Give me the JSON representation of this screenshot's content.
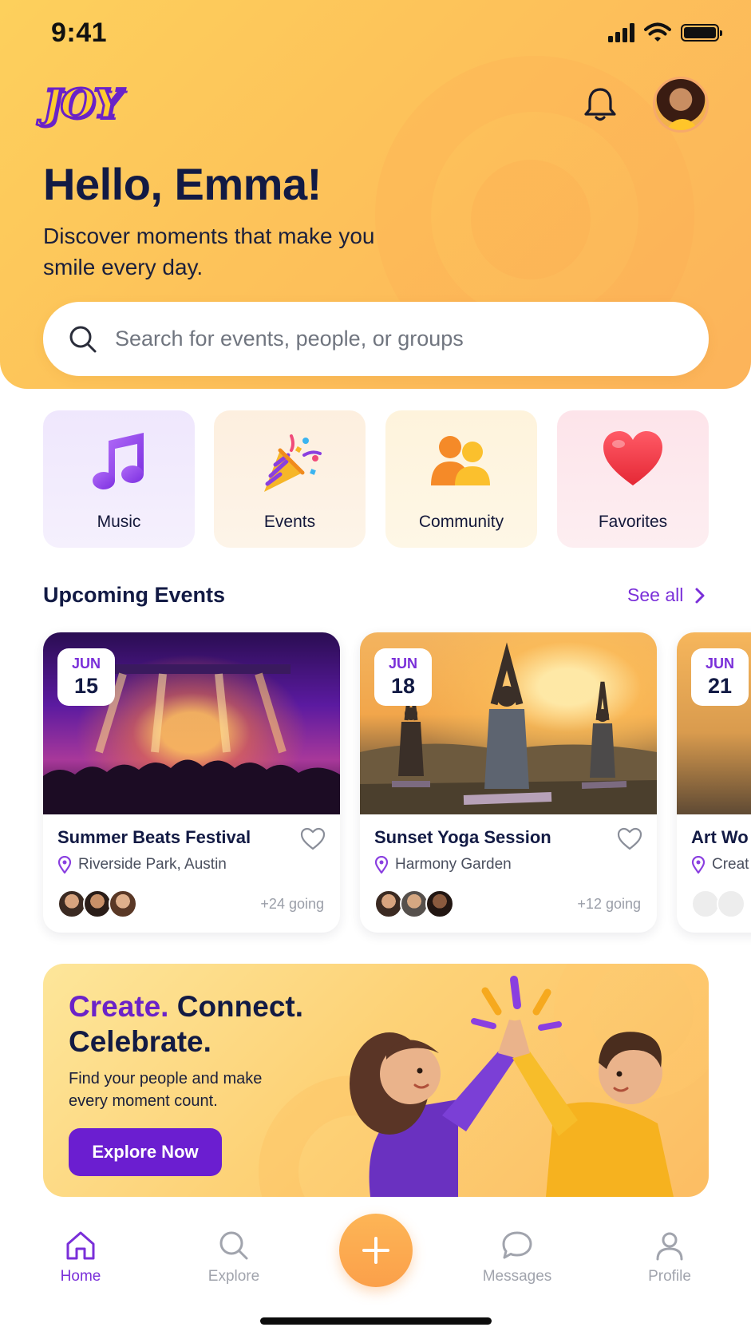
{
  "status_bar": {
    "time": "9:41"
  },
  "header": {
    "logo_text": "JOY",
    "greeting": "Hello, Emma!",
    "subtitle": "Discover moments that make you smile every day."
  },
  "search": {
    "placeholder": "Search for events, people, or groups"
  },
  "categories": [
    {
      "label": "Music",
      "icon": "music-note-icon"
    },
    {
      "label": "Events",
      "icon": "party-popper-icon"
    },
    {
      "label": "Community",
      "icon": "people-icon"
    },
    {
      "label": "Favorites",
      "icon": "heart-icon"
    }
  ],
  "upcoming": {
    "title": "Upcoming Events",
    "see_all": "See all",
    "events": [
      {
        "month": "JUN",
        "day": "15",
        "title": "Summer Beats Festival",
        "location": "Riverside Park, Austin",
        "going": "+24 going"
      },
      {
        "month": "JUN",
        "day": "18",
        "title": "Sunset Yoga Session",
        "location": "Harmony Garden",
        "going": "+12 going"
      },
      {
        "month": "JUN",
        "day": "21",
        "title": "Art Wo",
        "location": "Creat",
        "going": ""
      }
    ]
  },
  "promo": {
    "headline_accent": "Create.",
    "headline_rest_1": " Connect.",
    "headline_rest_2": "Celebrate.",
    "body": "Find your people and make every moment count.",
    "cta": "Explore Now"
  },
  "tab_bar": {
    "home": "Home",
    "explore": "Explore",
    "messages": "Messages",
    "profile": "Profile",
    "active": "Home"
  },
  "colors": {
    "accent": "#7a2fd9",
    "hero_yellow": "#fdc25a",
    "fab_orange": "#fba04a",
    "text_dark": "#121a44"
  }
}
